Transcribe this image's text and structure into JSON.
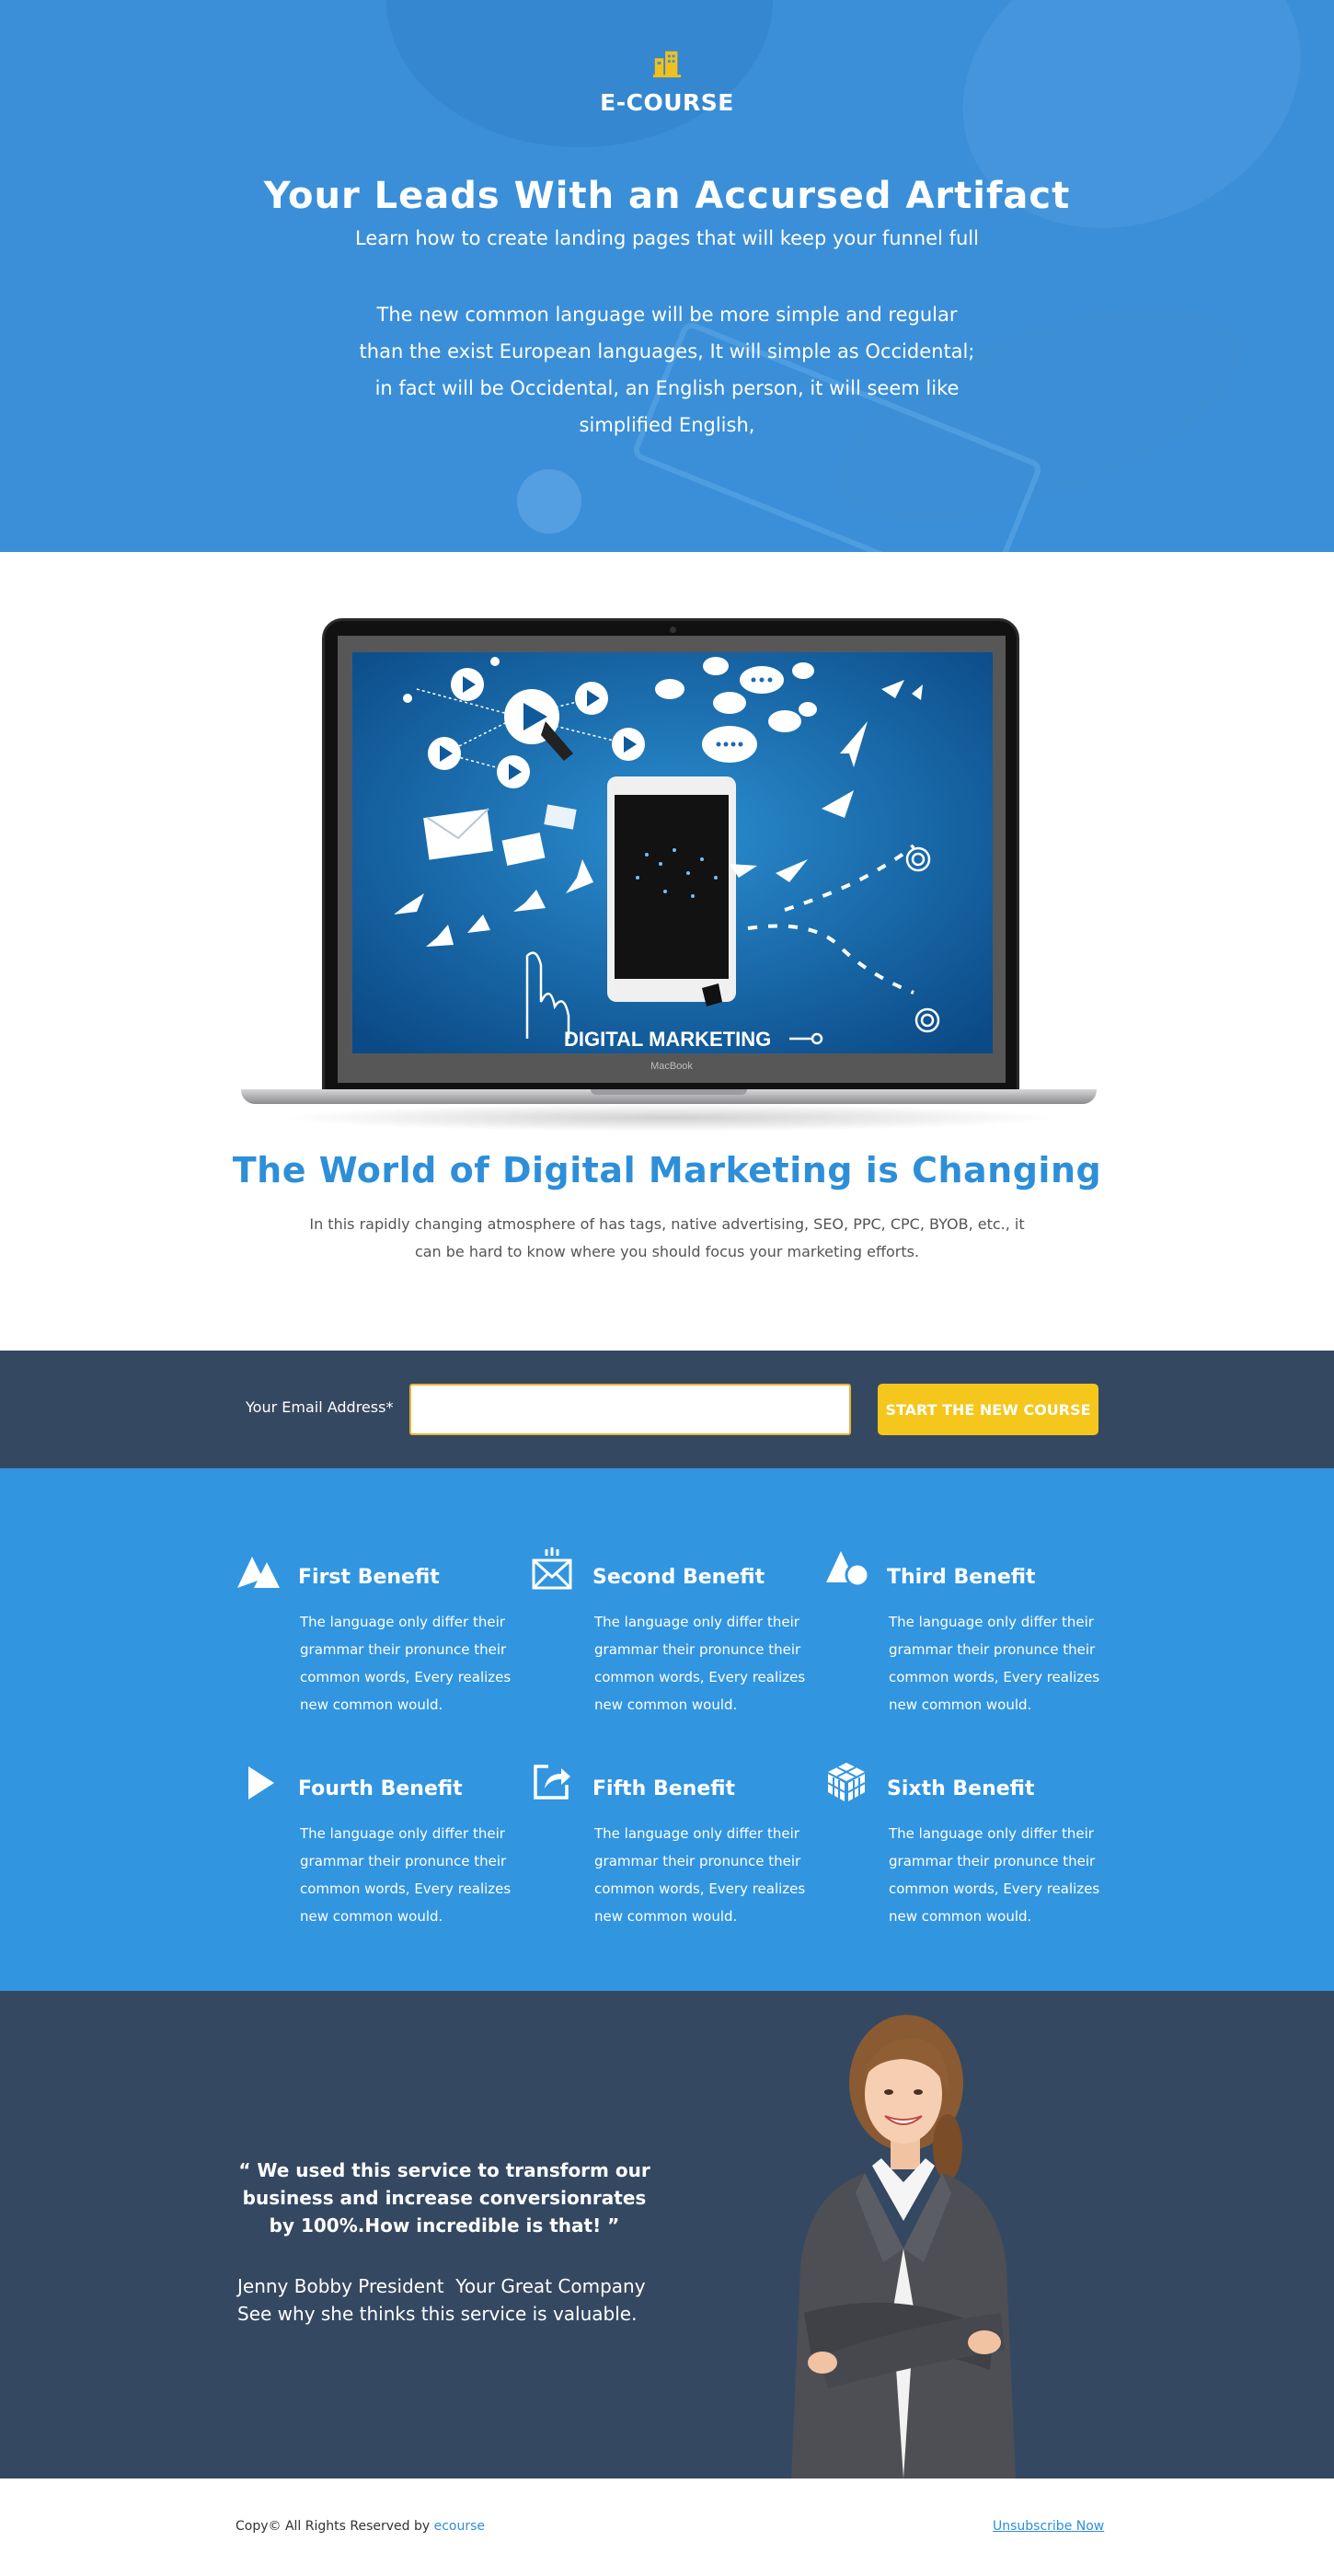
{
  "hero": {
    "logo_text": "E-COURSE",
    "title": "Your Leads With an Accursed Artifact",
    "subtitle": "Learn how to create landing pages that will keep your funnel full",
    "paragraph": "The new common language will be more simple and regular than the exist European languages, It will simple as Occidental; in fact will be Occidental, an English person, it will seem like simplified English,"
  },
  "showcase": {
    "laptop_brand": "MacBook",
    "screen_caption": "DIGITAL MARKETING",
    "title": "The World of Digital Marketing is Changing",
    "text": "In this rapidly changing atmosphere of has tags, native advertising, SEO, PPC, CPC, BYOB, etc., it can be hard to know where you should focus your marketing efforts."
  },
  "signup": {
    "label": "Your Email Address*",
    "input_value": "",
    "button_label": "START THE NEW COURSE"
  },
  "benefits": [
    {
      "icon": "mountain-icon",
      "title": "First Benefit",
      "text": "The language only differ their grammar their pronunce their common words, Every realizes new common would."
    },
    {
      "icon": "envelope-icon",
      "title": "Second Benefit",
      "text": "The language only differ their grammar their pronunce their common words, Every realizes new common would."
    },
    {
      "icon": "shapes-icon",
      "title": "Third Benefit",
      "text": "The language only differ their grammar their pronunce their common words, Every realizes new common would."
    },
    {
      "icon": "play-icon",
      "title": "Fourth Benefit",
      "text": "The language only differ their grammar their pronunce their common words, Every realizes new common would."
    },
    {
      "icon": "share-icon",
      "title": "Fifth Benefit",
      "text": "The language only differ their grammar their pronunce their common words, Every realizes new common would."
    },
    {
      "icon": "cube-icon",
      "title": "Sixth Benefit",
      "text": "The language only differ their grammar their pronunce their common words, Every realizes new common would."
    }
  ],
  "testimonial": {
    "quote": "“ We used this service to transform our business and increase conversionrates by 100%.How incredible is that! ”",
    "author": "Jenny Bobby President  Your Great Company\nSee why she thinks this service is valuable."
  },
  "footer": {
    "copy_prefix": "Copy© All Rights Reserved by",
    "brand_link": "ecourse",
    "unsubscribe": "Unsubscribe Now"
  },
  "colors": {
    "hero_blue": "#3a8fd8",
    "accent_blue": "#2e8fd8",
    "navy": "#344862",
    "yellow": "#f5c61b",
    "benefits_blue": "#3195e0"
  }
}
